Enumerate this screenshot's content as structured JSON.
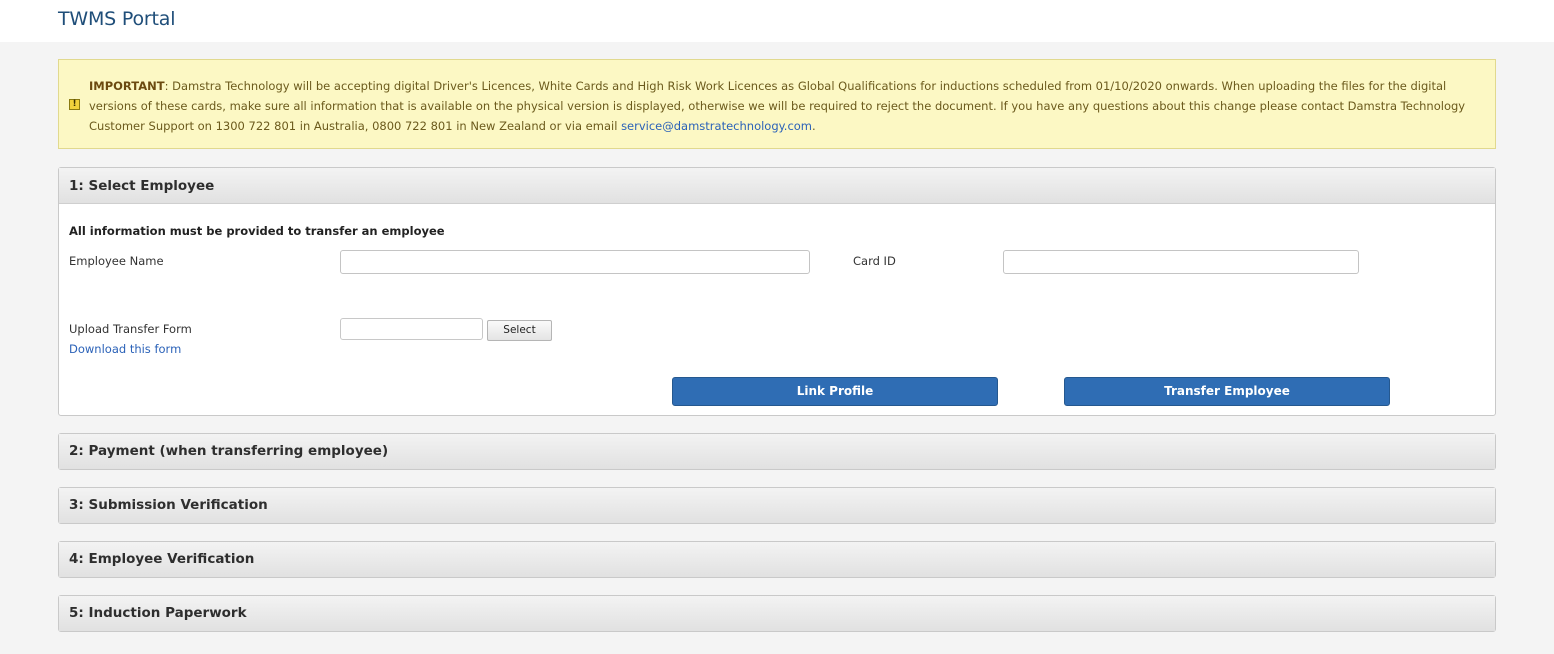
{
  "app": {
    "title": "TWMS Portal"
  },
  "notice": {
    "icon": "warning-icon",
    "lead": "IMPORTANT",
    "body": ": Damstra Technology will be accepting digital Driver's Licences, White Cards and High Risk Work Licences as Global Qualifications for inductions scheduled from 01/10/2020 onwards. When uploading the files for the digital versions of these cards, make sure all information that is available on the physical version is displayed, otherwise we will be required to reject the document. If you have any questions about this change please contact Damstra Technology Customer Support on 1300 722 801 in Australia, 0800 722 801 in New Zealand or via email ",
    "email": "service@damstratechnology.com",
    "tail": "."
  },
  "sections": {
    "select_employee": {
      "title": "1: Select Employee",
      "note": "All information must be provided to transfer an employee",
      "employee_name_label": "Employee Name",
      "employee_name_value": "",
      "card_id_label": "Card ID",
      "card_id_value": "",
      "upload_label": "Upload Transfer Form",
      "download_link": "Download this form",
      "select_button": "Select",
      "link_profile_button": "Link Profile",
      "transfer_button": "Transfer Employee"
    },
    "payment": {
      "title": "2: Payment (when transferring employee)"
    },
    "submission_verification": {
      "title": "3: Submission Verification"
    },
    "employee_verification": {
      "title": "4: Employee Verification"
    },
    "induction_paperwork": {
      "title": "5: Induction Paperwork"
    }
  },
  "colors": {
    "notice_bg": "#fcf8c4",
    "button_blue": "#2f6db4",
    "title_blue": "#1f4e79"
  }
}
